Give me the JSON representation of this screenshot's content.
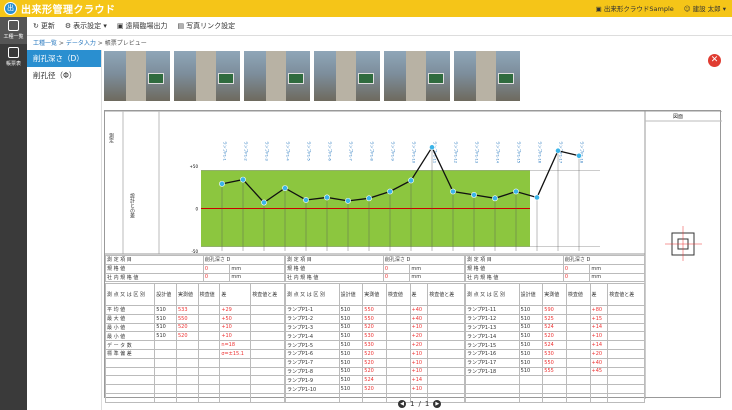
{
  "app": {
    "title": "出来形管理クラウド",
    "logo_glyph": "出"
  },
  "top_right": {
    "sample": "出来形クラウドSample",
    "user": "建設 太郎 ▾"
  },
  "sidenav": [
    {
      "label": "工種一覧",
      "active": true
    },
    {
      "label": "帳票表",
      "active": false
    }
  ],
  "toolbar": {
    "update": "更新",
    "display": "表示設定 ▾",
    "output": "遠隔臨場出力",
    "photo_link": "写真リンク設定"
  },
  "breadcrumb": {
    "home": "工種一覧",
    "sep": " > ",
    "input": "データ入力",
    "current": "帳票プレビュー"
  },
  "tree": [
    {
      "label": "削孔深さ（D）",
      "selected": true
    },
    {
      "label": "削孔径（Φ）",
      "selected": false
    }
  ],
  "photo_count": 6,
  "sheet": {
    "section_label": "図面",
    "label_chart": "測定",
    "label_y": "設計との差",
    "chart_data": {
      "type": "line",
      "categories": [
        "1",
        "2",
        "3",
        "4",
        "5",
        "6",
        "7",
        "8",
        "9",
        "10",
        "11",
        "12",
        "13",
        "14",
        "15",
        "16",
        "17",
        "18"
      ],
      "values": [
        29,
        34,
        7,
        24,
        10,
        13,
        9,
        12,
        20,
        33,
        72,
        20,
        16,
        12,
        20,
        13,
        68,
        62
      ],
      "ylim": [
        -50,
        50
      ],
      "yticks": [
        50,
        0,
        -50
      ],
      "ytick_labels": [
        "+50",
        "0",
        "-50"
      ],
      "thresholds": [
        45,
        -45
      ],
      "tick_prefix": "ランプP1-"
    },
    "blocks": [
      {
        "label_measure": "測 定 項 目",
        "measure": "削孔深さ D",
        "label_standard": "規 格 値",
        "standard_value": "0",
        "unit": "mm",
        "label_internal": "社 内 規 格 値",
        "internal_value": "0"
      },
      {
        "label_measure": "測 定 項 目",
        "measure": "削孔深さ D",
        "label_standard": "規 格 値",
        "standard_value": "0",
        "unit": "mm",
        "label_internal": "社 内 規 格 値",
        "internal_value": "0"
      },
      {
        "label_measure": "測 定 項 目",
        "measure": "削孔深さ D",
        "label_standard": "規 格 値",
        "standard_value": "0",
        "unit": "mm",
        "label_internal": "社 内 規 格 値",
        "internal_value": "0"
      }
    ],
    "headers": {
      "point": "測 点 又 は 区 別",
      "design": "設計値",
      "actual": "実測値",
      "check": "検査値",
      "diff": "差",
      "diff2": "検査値と差",
      "mm": "mm"
    },
    "stats": [
      {
        "label": "平 均 値",
        "design": "510",
        "actual": "533",
        "diff": "+29"
      },
      {
        "label": "最 大 値",
        "design": "510",
        "actual": "550",
        "diff": "+50"
      },
      {
        "label": "最 小 値",
        "design": "510",
        "actual": "520",
        "diff": "+10"
      },
      {
        "label": "最 小 値",
        "design": "510",
        "actual": "520",
        "diff": "+10"
      },
      {
        "label": "デ ー タ 数",
        "design": "",
        "actual": "",
        "diff": "n=18"
      },
      {
        "label": "標 準 偏 差",
        "design": "",
        "actual": "",
        "diff": "σ=±15.1"
      }
    ],
    "rows_mid": [
      {
        "p": "ランプP1-1",
        "d": "510",
        "a": "550",
        "diff": "+40"
      },
      {
        "p": "ランプP1-2",
        "d": "510",
        "a": "550",
        "diff": "+40"
      },
      {
        "p": "ランプP1-3",
        "d": "510",
        "a": "520",
        "diff": "+10"
      },
      {
        "p": "ランプP1-4",
        "d": "510",
        "a": "530",
        "diff": "+20"
      },
      {
        "p": "ランプP1-5",
        "d": "510",
        "a": "530",
        "diff": "+20"
      },
      {
        "p": "ランプP1-6",
        "d": "510",
        "a": "520",
        "diff": "+10"
      },
      {
        "p": "ランプP1-7",
        "d": "510",
        "a": "520",
        "diff": "+10"
      },
      {
        "p": "ランプP1-8",
        "d": "510",
        "a": "520",
        "diff": "+10"
      },
      {
        "p": "ランプP1-9",
        "d": "510",
        "a": "524",
        "diff": "+14"
      },
      {
        "p": "ランプP1-10",
        "d": "510",
        "a": "520",
        "diff": "+10"
      }
    ],
    "rows_right": [
      {
        "p": "ランプP1-11",
        "d": "510",
        "a": "590",
        "diff": "+80"
      },
      {
        "p": "ランプP1-12",
        "d": "510",
        "a": "525",
        "diff": "+15"
      },
      {
        "p": "ランプP1-13",
        "d": "510",
        "a": "524",
        "diff": "+14"
      },
      {
        "p": "ランプP1-14",
        "d": "510",
        "a": "520",
        "diff": "+10"
      },
      {
        "p": "ランプP1-15",
        "d": "510",
        "a": "524",
        "diff": "+14"
      },
      {
        "p": "ランプP1-16",
        "d": "510",
        "a": "530",
        "diff": "+20"
      },
      {
        "p": "ランプP1-17",
        "d": "510",
        "a": "550",
        "diff": "+40"
      },
      {
        "p": "ランプP1-18",
        "d": "510",
        "a": "555",
        "diff": "+45"
      }
    ]
  },
  "pager": {
    "current": "1",
    "sep": "/",
    "total": "1"
  },
  "colors": {
    "accent": "#2a8fd0",
    "topbar": "#f5c518",
    "band": "#8cc63f",
    "danger": "#e03c31"
  }
}
